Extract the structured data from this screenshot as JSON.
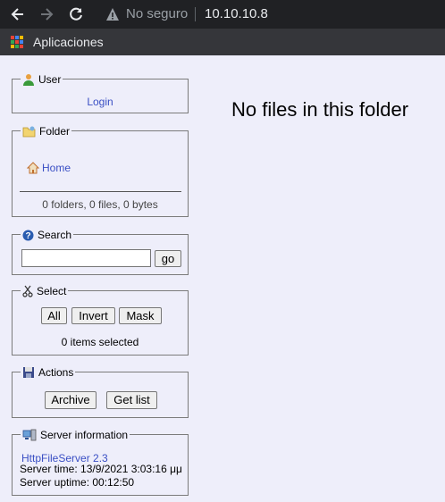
{
  "browser": {
    "security_label": "No seguro",
    "url": "10.10.10.8",
    "bookmarks_apps_label": "Aplicaciones"
  },
  "sidebar": {
    "user": {
      "title": "User",
      "login_label": "Login"
    },
    "folder": {
      "title": "Folder",
      "home_label": "Home",
      "summary": "0 folders, 0 files, 0 bytes"
    },
    "search": {
      "title": "Search",
      "input_value": "",
      "go_label": "go"
    },
    "select": {
      "title": "Select",
      "all_label": "All",
      "invert_label": "Invert",
      "mask_label": "Mask",
      "status": "0 items selected"
    },
    "actions": {
      "title": "Actions",
      "archive_label": "Archive",
      "getlist_label": "Get list"
    },
    "server": {
      "title": "Server information",
      "software_link": "HttpFileServer 2.3",
      "time_text": "Server time: 13/9/2021 3:03:16 μμ",
      "uptime_text": "Server uptime: 00:12:50"
    }
  },
  "main": {
    "message": "No files in this folder"
  },
  "colors": {
    "link": "#3a4fc4",
    "page_bg": "#eeeefa",
    "chrome_bg": "#202124"
  }
}
